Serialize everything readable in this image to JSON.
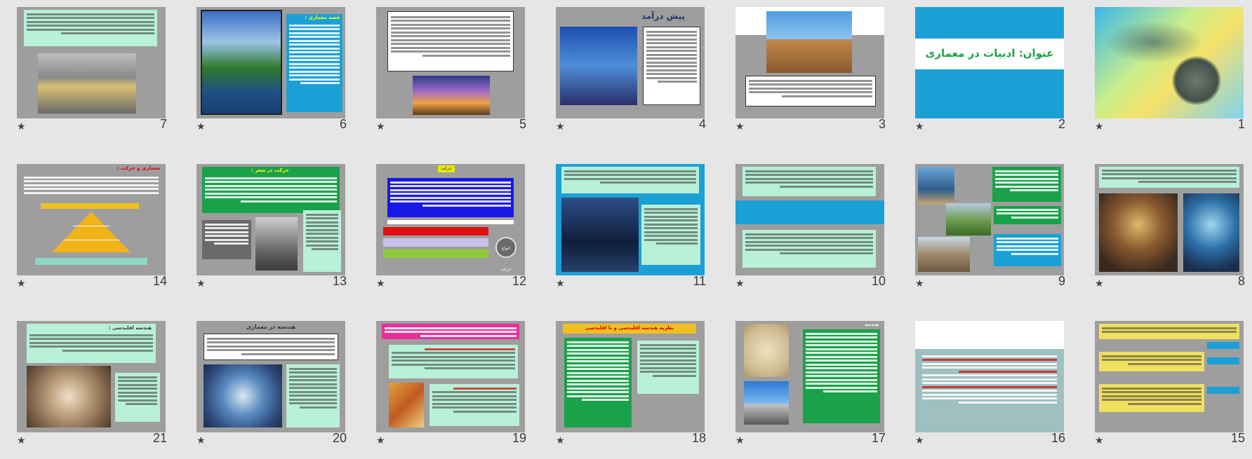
{
  "view": "slide-sorter",
  "slides": [
    {
      "number": "1",
      "star": "★"
    },
    {
      "number": "2",
      "star": "★",
      "title": "عنوان: ادبیات در معماری"
    },
    {
      "number": "3",
      "star": "★"
    },
    {
      "number": "4",
      "star": "★",
      "title": "پیش درآمد"
    },
    {
      "number": "5",
      "star": "★"
    },
    {
      "number": "6",
      "star": "★",
      "title": "قصه معماری :"
    },
    {
      "number": "7",
      "star": "★"
    },
    {
      "number": "8",
      "star": "★"
    },
    {
      "number": "9",
      "star": "★"
    },
    {
      "number": "10",
      "star": "★"
    },
    {
      "number": "11",
      "star": "★"
    },
    {
      "number": "12",
      "star": "★",
      "title": "انواع حرکت",
      "badge": "حرکت"
    },
    {
      "number": "13",
      "star": "★",
      "title": "حرکت در شعر :"
    },
    {
      "number": "14",
      "star": "★",
      "title": "معماری و حرکت :"
    },
    {
      "number": "15",
      "star": "★"
    },
    {
      "number": "16",
      "star": "★"
    },
    {
      "number": "17",
      "star": "★",
      "title": "هندسه"
    },
    {
      "number": "18",
      "star": "★",
      "title": "نظریه هندسه اقلیدسی و نا اقلیدسی"
    },
    {
      "number": "19",
      "star": "★"
    },
    {
      "number": "20",
      "star": "★",
      "title": "هندسه در معماری"
    },
    {
      "number": "21",
      "star": "★",
      "title": "هندسه اقلیدسی :"
    }
  ]
}
